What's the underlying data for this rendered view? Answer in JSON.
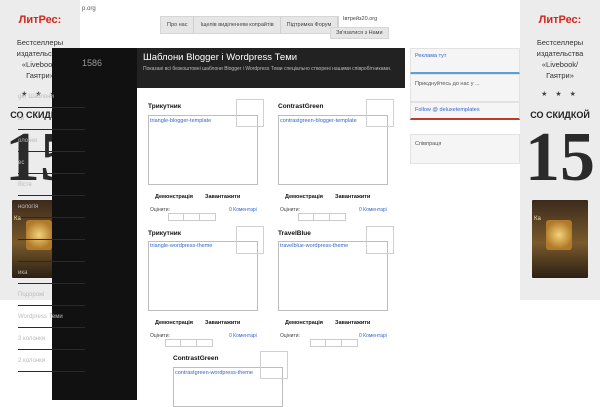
{
  "ads": {
    "brand": "ЛитРес:",
    "lines": [
      "Бестселлеры",
      "издательства",
      "«Livebook/",
      "Гаятри»"
    ],
    "stars": "★ ★ ★",
    "sale": "СО СКИДКОЙ",
    "percent": "15",
    "book_title": "Ка"
  },
  "header": {
    "logo_text": "p.org",
    "nav": [
      "Про нас",
      "Іщелів виділенням копрайтів",
      "Підтримка Форум"
    ],
    "badge": "Івтрейз20.org",
    "contact": "Зв'язатися з Нами"
  },
  "sidebar": {
    "stat": "1586",
    "items": [
      "ger Шаблони",
      "ки",
      "олонки",
      "ес",
      "бісте",
      "нологія",
      "",
      "",
      "ика",
      "Подорожі",
      "Wordpress Теми",
      "3 колонки",
      "2 колонки"
    ]
  },
  "main": {
    "title": "Шаблони Blogger і Wordpress Теми",
    "description": "Показані всі безкоштовні шаблони Blogger і Wordpress Теми спеціально створені нашими співробітниками."
  },
  "cards": [
    {
      "title": "Трикутник",
      "link": "triangle-blogger-template",
      "demo": "Демонстрація",
      "download": "Завантажити",
      "rating_label": "Оцінити:",
      "comments": "0 Коментарі"
    },
    {
      "title": "ContrastGreen",
      "link": "contrastgreen-blogger-template",
      "demo": "Демонстрація",
      "download": "Завантажити",
      "rating_label": "Оцінити:",
      "comments": "0 Коментарі"
    },
    {
      "title": "Трикутник",
      "link": "triangle-wordpress-theme",
      "demo": "Демонстрація",
      "download": "Завантажити",
      "rating_label": "Оцінити:",
      "comments": "0 Коментарі"
    },
    {
      "title": "TravelBlue",
      "link": "travelblue-wordpress-theme",
      "demo": "Демонстрація",
      "download": "Завантажити",
      "rating_label": "Оцінити:",
      "comments": "0 Коментарі"
    },
    {
      "title": "ContrastGreen",
      "link": "contrastgreen-wordpress-theme"
    }
  ],
  "right": {
    "ad_label": "Реклама тут",
    "like_text": "Приєднуйтесь до нас у ...",
    "follow": "Follow @ deluxetemplates",
    "contacts": "Співпраця"
  },
  "colors": {
    "accent_link": "#3366cc",
    "dark": "#111111",
    "ad_brand": "#d4261c"
  }
}
